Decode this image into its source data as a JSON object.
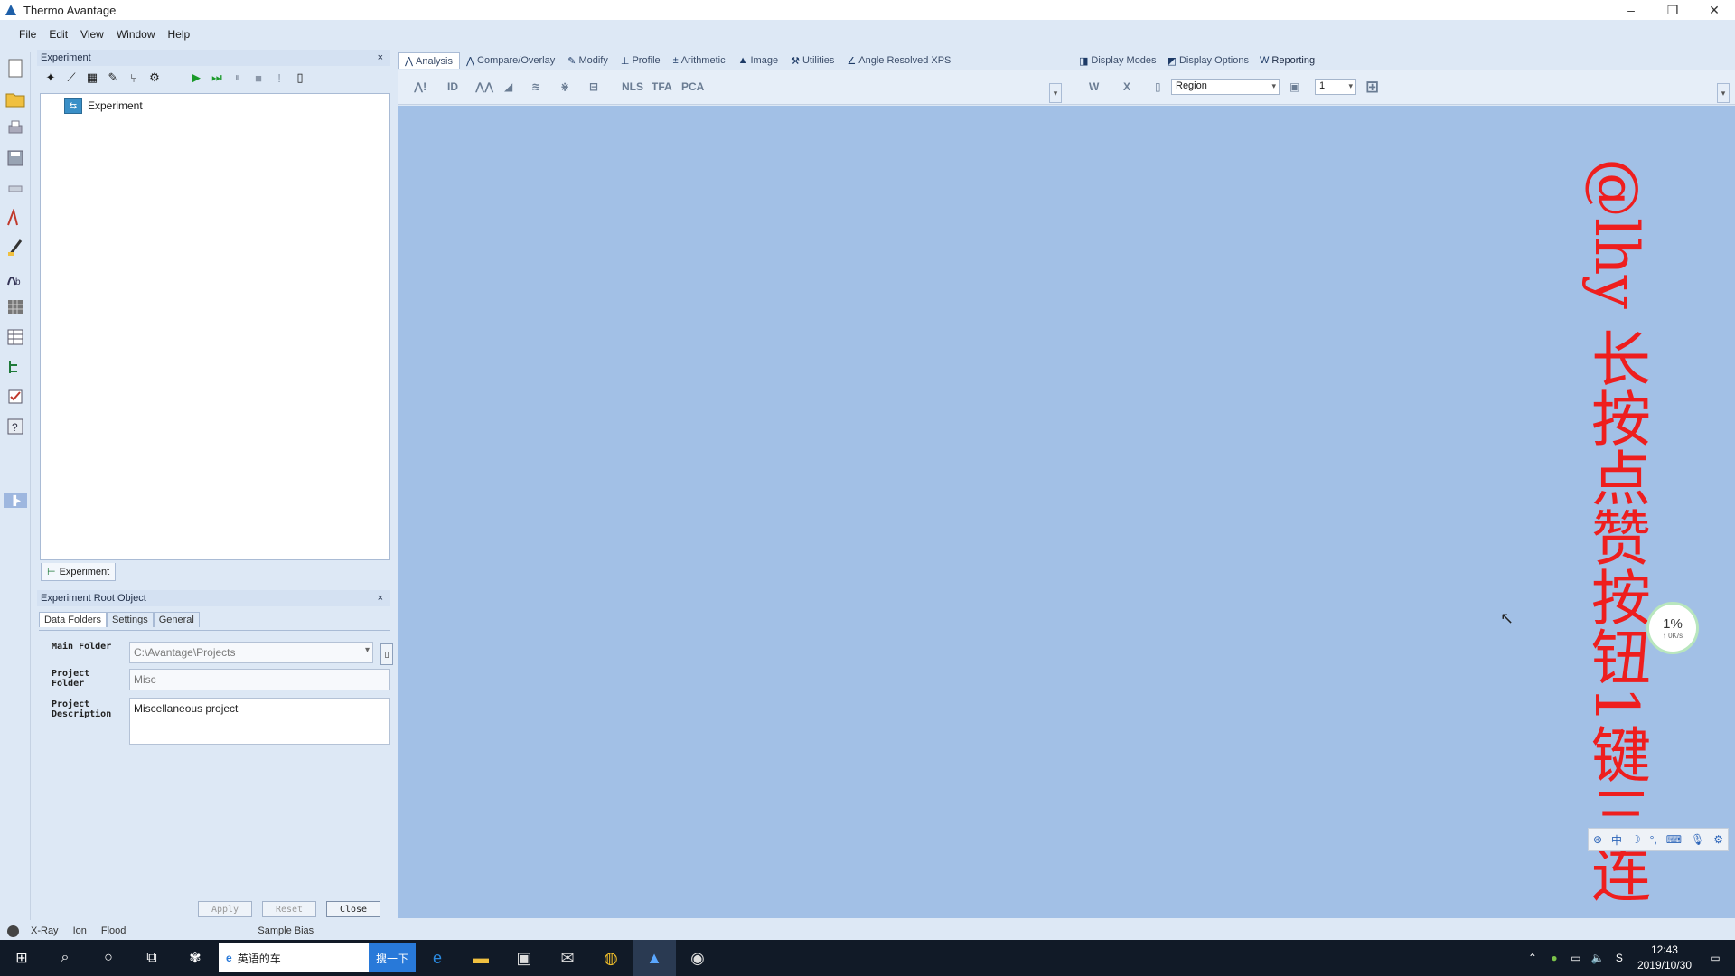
{
  "window": {
    "title": "Thermo Avantage",
    "controls": [
      "–",
      "❐",
      "✕"
    ]
  },
  "menu": [
    "File",
    "Edit",
    "View",
    "Window",
    "Help"
  ],
  "experiment_panel": {
    "title": "Experiment",
    "close": "×",
    "tree_root": "Experiment",
    "tab_label": "Experiment"
  },
  "root_panel": {
    "title": "Experiment Root Object",
    "close": "×",
    "tabs": [
      "Data Folders",
      "Settings",
      "General"
    ],
    "fields": {
      "main_folder_label": "Main Folder",
      "main_folder_value": "C:\\Avantage\\Projects",
      "project_folder_label": "Project Folder",
      "project_folder_value": "Misc",
      "project_description_label": "Project Description",
      "project_description_value": "Miscellaneous project"
    },
    "buttons": {
      "apply": "Apply",
      "reset": "Reset",
      "close": "Close"
    }
  },
  "ribbon": {
    "tabs": [
      "Analysis",
      "Compare/Overlay",
      "Modify",
      "Profile",
      "Arithmetic",
      "Image",
      "Utilities",
      "Angle Resolved XPS"
    ],
    "right_tabs": [
      "Display Modes",
      "Display Options",
      "Reporting"
    ],
    "tool_labels": [
      "ID",
      "NLS",
      "TFA",
      "PCA"
    ],
    "region_select": "Region",
    "number_select": "1"
  },
  "overlay": {
    "text": "@lhy 长按点赞按钮1键三连",
    "speed_percent": "1%",
    "speed_rate": "↑ 0K/s"
  },
  "statusbar": [
    "X-Ray",
    "Ion",
    "Flood",
    "Sample Bias"
  ],
  "taskbar": {
    "search_text": "英语的车",
    "search_button": "搜一下",
    "clock_time": "12:43",
    "clock_date": "2019/10/30"
  },
  "colors": {
    "workspace": "#a2c0e6",
    "chrome": "#dde8f5",
    "overlay_red": "#ee1e1e",
    "taskbar": "#111a27"
  }
}
